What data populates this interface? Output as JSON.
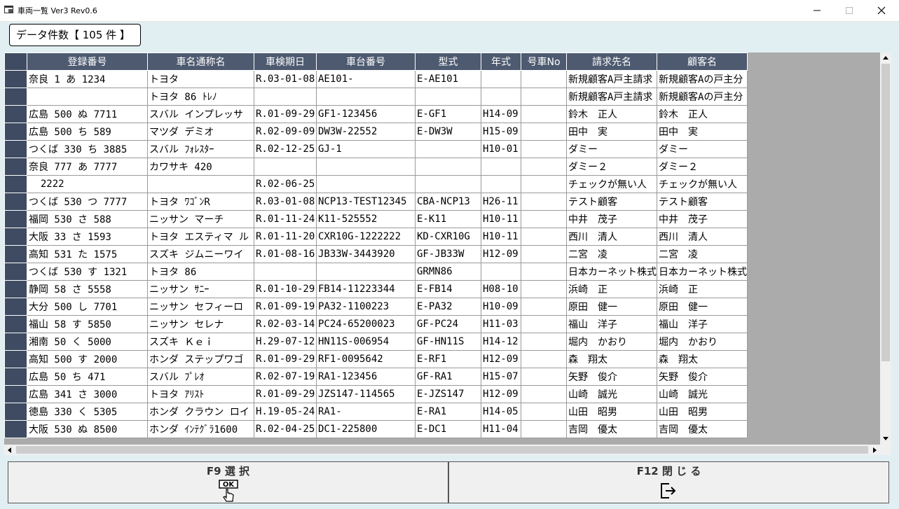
{
  "window": {
    "title": "車両一覧 Ver3 Rev0.6"
  },
  "count_label": "データ件数【 105 件 】",
  "table": {
    "columns": [
      "登録番号",
      "車名通称名",
      "車検期日",
      "車台番号",
      "型式",
      "年式",
      "号車No",
      "請求先名",
      "顧客名"
    ],
    "rows": [
      [
        "奈良 1 あ 1234",
        "トヨタ",
        "R.03-01-08",
        "AE101-",
        "E-AE101",
        "",
        "",
        "新規顧客A戸主請求",
        "新規顧客Aの戸主分"
      ],
      [
        "",
        "トヨタ 86 ﾄﾚﾉ",
        "",
        "",
        "",
        "",
        "",
        "新規顧客A戸主請求",
        "新規顧客Aの戸主分"
      ],
      [
        "広島 500 ぬ 7711",
        "スバル インプレッサ",
        "R.01-09-29",
        "GF1-123456",
        "E-GF1",
        "H14-09",
        "",
        "鈴木　正人",
        "鈴木　正人"
      ],
      [
        "広島 500 ち 589",
        "マツダ デミオ",
        "R.02-09-09",
        "DW3W-22552",
        "E-DW3W",
        "H15-09",
        "",
        "田中　実",
        "田中　実"
      ],
      [
        "つくば 330 ち 3885",
        "スバル ﾌｫﾚｽﾀｰ",
        "R.02-12-25",
        "GJ-1",
        "",
        "H10-01",
        "",
        "ダミー",
        "ダミー"
      ],
      [
        "奈良 777 あ 7777",
        "カワサキ 420",
        "",
        "",
        "",
        "",
        "",
        "ダミー２",
        "ダミー２"
      ],
      [
        "  2222",
        "",
        "R.02-06-25",
        "",
        "",
        "",
        "",
        "チェックが無い人",
        "チェックが無い人"
      ],
      [
        "つくば 530 つ 7777",
        "トヨタ ﾜｺﾞﾝR",
        "R.03-01-08",
        "NCP13-TEST12345",
        "CBA-NCP13",
        "H26-11",
        "",
        "テスト顧客",
        "テスト顧客"
      ],
      [
        "福岡 530 さ 588",
        "ニッサン マーチ",
        "R.01-11-24",
        "K11-525552",
        "E-K11",
        "H10-11",
        "",
        "中井　茂子",
        "中井　茂子"
      ],
      [
        "大阪 33 さ 1593",
        "トヨタ エスティマ ル",
        "R.01-11-20",
        "CXR10G-1222222",
        "KD-CXR10G",
        "H10-11",
        "",
        "西川　清人",
        "西川　清人"
      ],
      [
        "高知 531 た 1575",
        "スズキ ジムニーワイ",
        "R.01-08-16",
        "JB33W-3443920",
        "GF-JB33W",
        "H12-09",
        "",
        "二宮　凌",
        "二宮　凌"
      ],
      [
        "つくば 530 す 1321",
        "トヨタ 86",
        "",
        "",
        "GRMN86",
        "",
        "",
        "日本カーネット株式",
        "日本カーネット株式"
      ],
      [
        "静岡 58 さ 5558",
        "ニッサン ｻﾆｰ",
        "R.01-10-29",
        "FB14-11223344",
        "E-FB14",
        "H08-10",
        "",
        "浜崎　正",
        "浜崎　正"
      ],
      [
        "大分 500 し 7701",
        "ニッサン セフィーロ",
        "R.01-09-19",
        "PA32-1100223",
        "E-PA32",
        "H10-09",
        "",
        "原田　健一",
        "原田　健一"
      ],
      [
        "福山 58 す 5850",
        "ニッサン セレナ",
        "R.02-03-14",
        "PC24-65200023",
        "GF-PC24",
        "H11-03",
        "",
        "福山　洋子",
        "福山　洋子"
      ],
      [
        "湘南 50 く 5000",
        "スズキ Ｋｅｉ",
        "H.29-07-12",
        "HN11S-006954",
        "GF-HN11S",
        "H14-12",
        "",
        "堀内　かおり",
        "堀内　かおり"
      ],
      [
        "高知 500 す 2000",
        "ホンダ ステップワゴ",
        "R.01-09-29",
        "RF1-0095642",
        "E-RF1",
        "H12-09",
        "",
        "森　翔太",
        "森　翔太"
      ],
      [
        "広島 50 ち 471",
        "スバル ﾌﾟﾚｵ",
        "R.02-07-19",
        "RA1-123456",
        "GF-RA1",
        "H15-07",
        "",
        "矢野　俊介",
        "矢野　俊介"
      ],
      [
        "広島 341 さ 3000",
        "トヨタ ｱﾘｽﾄ",
        "R.01-09-29",
        "JZS147-114565",
        "E-JZS147",
        "H12-09",
        "",
        "山崎　誠光",
        "山崎　誠光"
      ],
      [
        "徳島 330 く 5305",
        "ホンダ クラウン ロイ",
        "H.19-05-24",
        "RA1-",
        "E-RA1",
        "H14-05",
        "",
        "山田　昭男",
        "山田　昭男"
      ],
      [
        "大阪 530 ぬ 8500",
        "ホンダ ｲﾝﾃｸﾞﾗ1600",
        "R.02-04-25",
        "DC1-225800",
        "E-DC1",
        "H11-04",
        "",
        "吉岡　優太",
        "吉岡　優太"
      ]
    ]
  },
  "buttons": {
    "f9_label": "F9 選 択",
    "f9_icon_text": "OK",
    "f12_label": "F12 閉 じ る"
  },
  "colors": {
    "background": "#e1eff3",
    "header": "#4d5a70",
    "row_header": "#3f4b62",
    "grid_empty": "#ababab"
  }
}
